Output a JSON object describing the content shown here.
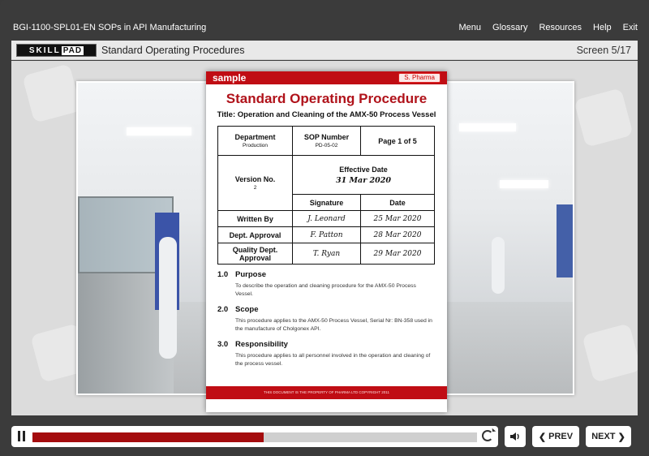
{
  "course_title": "BGI-1100-SPL01-EN SOPs in API Manufacturing",
  "top_nav": [
    "Menu",
    "Glossary",
    "Resources",
    "Help",
    "Exit"
  ],
  "logo": {
    "left": "SKILL",
    "right": "PAD"
  },
  "screen_title": "Standard Operating Procedures",
  "screen_count": "Screen 5/17",
  "document": {
    "header_label": "sample",
    "company_badge": "S. Pharma",
    "title": "Standard Operating Procedure",
    "subtitle": "Title: Operation and Cleaning of the AMX-50 Process Vessel",
    "department_label": "Department",
    "department_value": "Production",
    "sop_number_label": "SOP Number",
    "sop_number_value": "PD-05-02",
    "page_label": "Page 1 of 5",
    "version_label": "Version No.",
    "version_value": "2",
    "effective_date_label": "Effective Date",
    "effective_date_value": "31 Mar 2020",
    "signature_header": "Signature",
    "date_header": "Date",
    "approvals": [
      {
        "role": "Written By",
        "signature": "J. Leonard",
        "date": "25 Mar 2020"
      },
      {
        "role": "Dept. Approval",
        "signature": "F. Patton",
        "date": "28 Mar 2020"
      },
      {
        "role": "Quality Dept. Approval",
        "signature": "T. Ryan",
        "date": "29 Mar 2020"
      }
    ],
    "sections": [
      {
        "number": "1.0",
        "heading": "Purpose",
        "body": "To describe the operation and cleaning procedure for the AMX-50 Process Vessel."
      },
      {
        "number": "2.0",
        "heading": "Scope",
        "body": "This procedure applies to the AMX-50 Process Vessel, Serial Nr: BN-358 used in the manufacture of Cholgonex API."
      },
      {
        "number": "3.0",
        "heading": "Responsibility",
        "body": "This procedure applies to all personnel involved in the operation and cleaning of the process vessel."
      }
    ],
    "footer_text": "THIS DOCUMENT IS THE PROPERTY OF PHARMA LTD COPYRIGHT 2011"
  },
  "player": {
    "progress_fraction": 0.52,
    "prev_label": "PREV",
    "next_label": "NEXT",
    "accent_color": "#a40c0e"
  }
}
